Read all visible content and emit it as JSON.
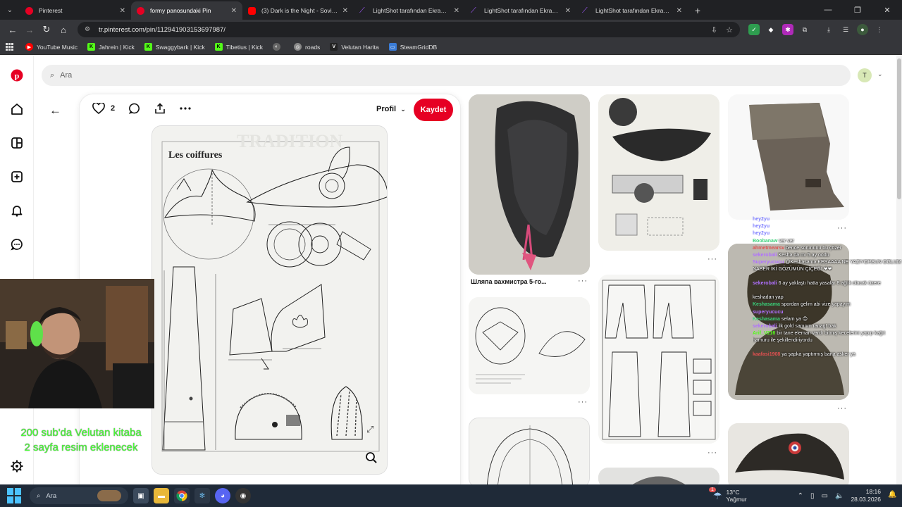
{
  "browser": {
    "tabs": [
      {
        "label": "Pinterest",
        "favicon_color": "#e60023",
        "active": false
      },
      {
        "label": "formy panosundaki Pin",
        "favicon_color": "#e60023",
        "active": true
      },
      {
        "label": "(3) Dark is the Night - Soviet W",
        "favicon_color": "#ff0000",
        "active": false
      },
      {
        "label": "LightShot tarafından Ekran Gör",
        "favicon_color": "#a259ff",
        "active": false
      },
      {
        "label": "LightShot tarafından Ekran Gör",
        "favicon_color": "#a259ff",
        "active": false
      },
      {
        "label": "LightShot tarafından Ekran Gör",
        "favicon_color": "#a259ff",
        "active": false
      }
    ],
    "url": "tr.pinterest.com/pin/112941903153697987/",
    "bookmarks": [
      {
        "label": "YouTube Music",
        "icon_color": "#ff0000",
        "icon": "▶"
      },
      {
        "label": "Jahrein | Kick",
        "icon_color": "#53fc18",
        "icon": "K"
      },
      {
        "label": "Swaggybark | Kick",
        "icon_color": "#53fc18",
        "icon": "K"
      },
      {
        "label": "Tibetius | Kick",
        "icon_color": "#53fc18",
        "icon": "K"
      },
      {
        "label": "",
        "icon_color": "#777777",
        "icon": "◐"
      },
      {
        "label": "roads",
        "icon_color": "#888888",
        "icon": "◎"
      },
      {
        "label": "Velutan Harita",
        "icon_color": "#333333",
        "icon": "V"
      },
      {
        "label": "SteamGridDB",
        "icon_color": "#3a7bd5",
        "icon": "▭"
      }
    ]
  },
  "pinterest": {
    "search_placeholder": "Ara",
    "avatar_letter": "T",
    "likes": "2",
    "profile_label": "Profil",
    "save_label": "Kaydet",
    "pin_title": "Les coiffures",
    "grid_caption": "Шляпа вахмистра 5-го...",
    "brand_color": "#e60023"
  },
  "stream": {
    "overlay_text_line1": "200 sub'da Velutan kitaba",
    "overlay_text_line2": "2 sayfa resim eklenecek",
    "chat": [
      {
        "user": "hey2yu",
        "msg": "",
        "color": "#7b7bff"
      },
      {
        "user": "hey2yu",
        "msg": "",
        "color": "#7b7bff"
      },
      {
        "user": "hey2yu",
        "msg": "",
        "color": "#7b7bff"
      },
      {
        "user": "Boobanaw",
        "msg": "ver ver",
        "color": "#3ad17a"
      },
      {
        "user": "ahmetmearsv",
        "msg": "bence sorununu bu çözer",
        "color": "#e05050"
      },
      {
        "user": "sekerobali",
        "msg": "Kesha da mı 5 ay oodu",
        "color": "#b070ff"
      },
      {
        "user": "Superyucucu",
        "msg": "@Keshasama KEŞAAAA NE YAZIYORSUN OĞLUM NABER İKİ GÖZÜMÜN ÇİÇEĞİ ❤❤",
        "color": "#b070ff"
      },
      {
        "user": "sekerobali",
        "msg": "6 ay yaklaştı hatta yasalar 8 ağlık olacak üzere",
        "color": "#b070ff"
      },
      {
        "user": "",
        "msg": "keshadan yap",
        "color": "#ffffff"
      },
      {
        "user": "Keshasama",
        "msg": "spordan gelim abi vize yapayım",
        "color": "#3ad17a"
      },
      {
        "user": "superyucucu",
        "msg": "",
        "color": "#b070ff"
      },
      {
        "user": "Keshasama",
        "msg": "selam ya 😊",
        "color": "#3ad17a"
      },
      {
        "user": "sekerobali",
        "msg": "ilk gold sanırım ranag! bak",
        "color": "#b070ff"
      },
      {
        "user": "Arif_V216",
        "msg": "bir tane eleman vardı bitmiş kecelerini yapıp kağıt hamuru ile şekillendiriyordu",
        "color": "#53fc18"
      },
      {
        "user": "kaafasi1908",
        "msg": "ya şapka yaptırmış bana asker ya",
        "color": "#e05050"
      }
    ]
  },
  "taskbar": {
    "search_placeholder": "Ara",
    "weather_temp": "13°C",
    "weather_desc": "Yağmur",
    "time": "18:16",
    "date": "28.03.2026",
    "notification_count": "1"
  }
}
